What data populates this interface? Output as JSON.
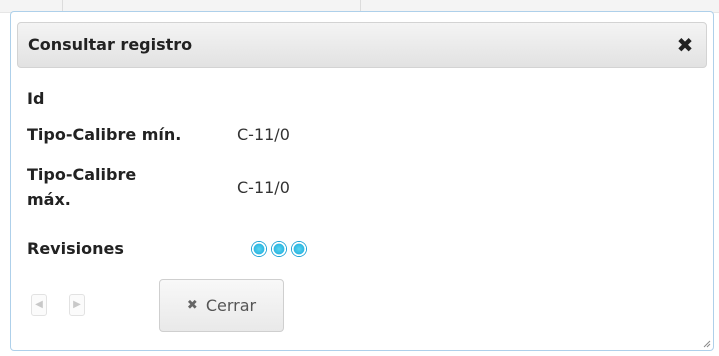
{
  "dialog": {
    "title": "Consultar registro",
    "close_glyph": "✖",
    "fields": [
      {
        "label": "Id",
        "value": ""
      },
      {
        "label": "Tipo-Calibre mín.",
        "value": "C-11/0"
      },
      {
        "label": "Tipo-Calibre máx.",
        "value": "C-11/0"
      },
      {
        "label": "Revisiones",
        "value": ""
      }
    ],
    "revisions_count": 3,
    "nav": {
      "prev_glyph": "◀",
      "next_glyph": "▶"
    },
    "close_button": {
      "icon_glyph": "✖",
      "label": "Cerrar"
    }
  },
  "icons": {
    "close": "close-icon",
    "prev": "prev-arrow-icon",
    "next": "next-arrow-icon",
    "cerrar": "x-icon",
    "revision": "revision-dot-icon",
    "resize": "resize-grip-icon"
  },
  "colors": {
    "border": "#aed0ea",
    "revision_dot": "#2fb8e2"
  }
}
